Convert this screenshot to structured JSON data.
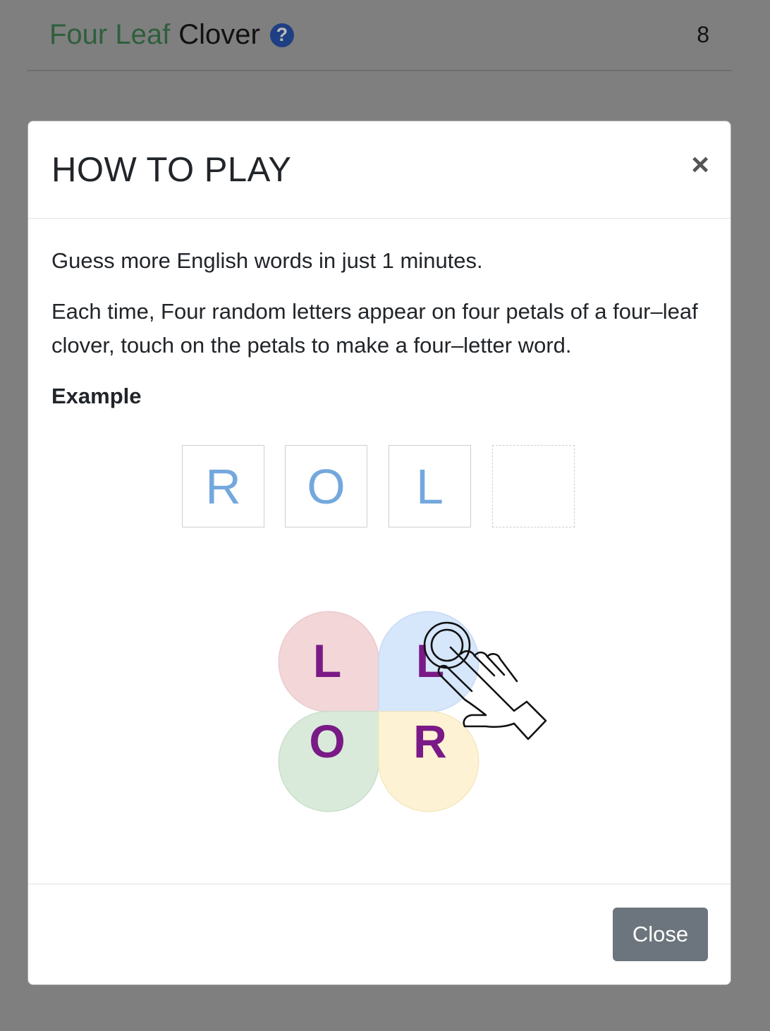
{
  "app": {
    "title_green": "Four Leaf",
    "title_plain": "Clover",
    "help_icon": "question-circle-icon",
    "score": "8"
  },
  "modal": {
    "title": "HOW TO PLAY",
    "close_icon": "×",
    "intro": "Guess more English words in just 1 minutes.",
    "instructions": "Each time, Four random letters appear on four petals of a four–leaf clover, touch on the petals to make a four–letter word.",
    "example_heading": "Example",
    "slots": [
      "R",
      "O",
      "L",
      ""
    ],
    "petals": [
      "L",
      "L",
      "O",
      "R"
    ],
    "close_button": "Close"
  },
  "colors": {
    "backdrop": "#7f7f7f",
    "petal_top_left": "#f2d6d8",
    "petal_top_right": "#d6e6fb",
    "petal_bottom_left": "#d9eadb",
    "petal_bottom_right": "#fdf3d4",
    "petal_letter": "#7a1a86",
    "slot_letter": "#74a8dd"
  }
}
